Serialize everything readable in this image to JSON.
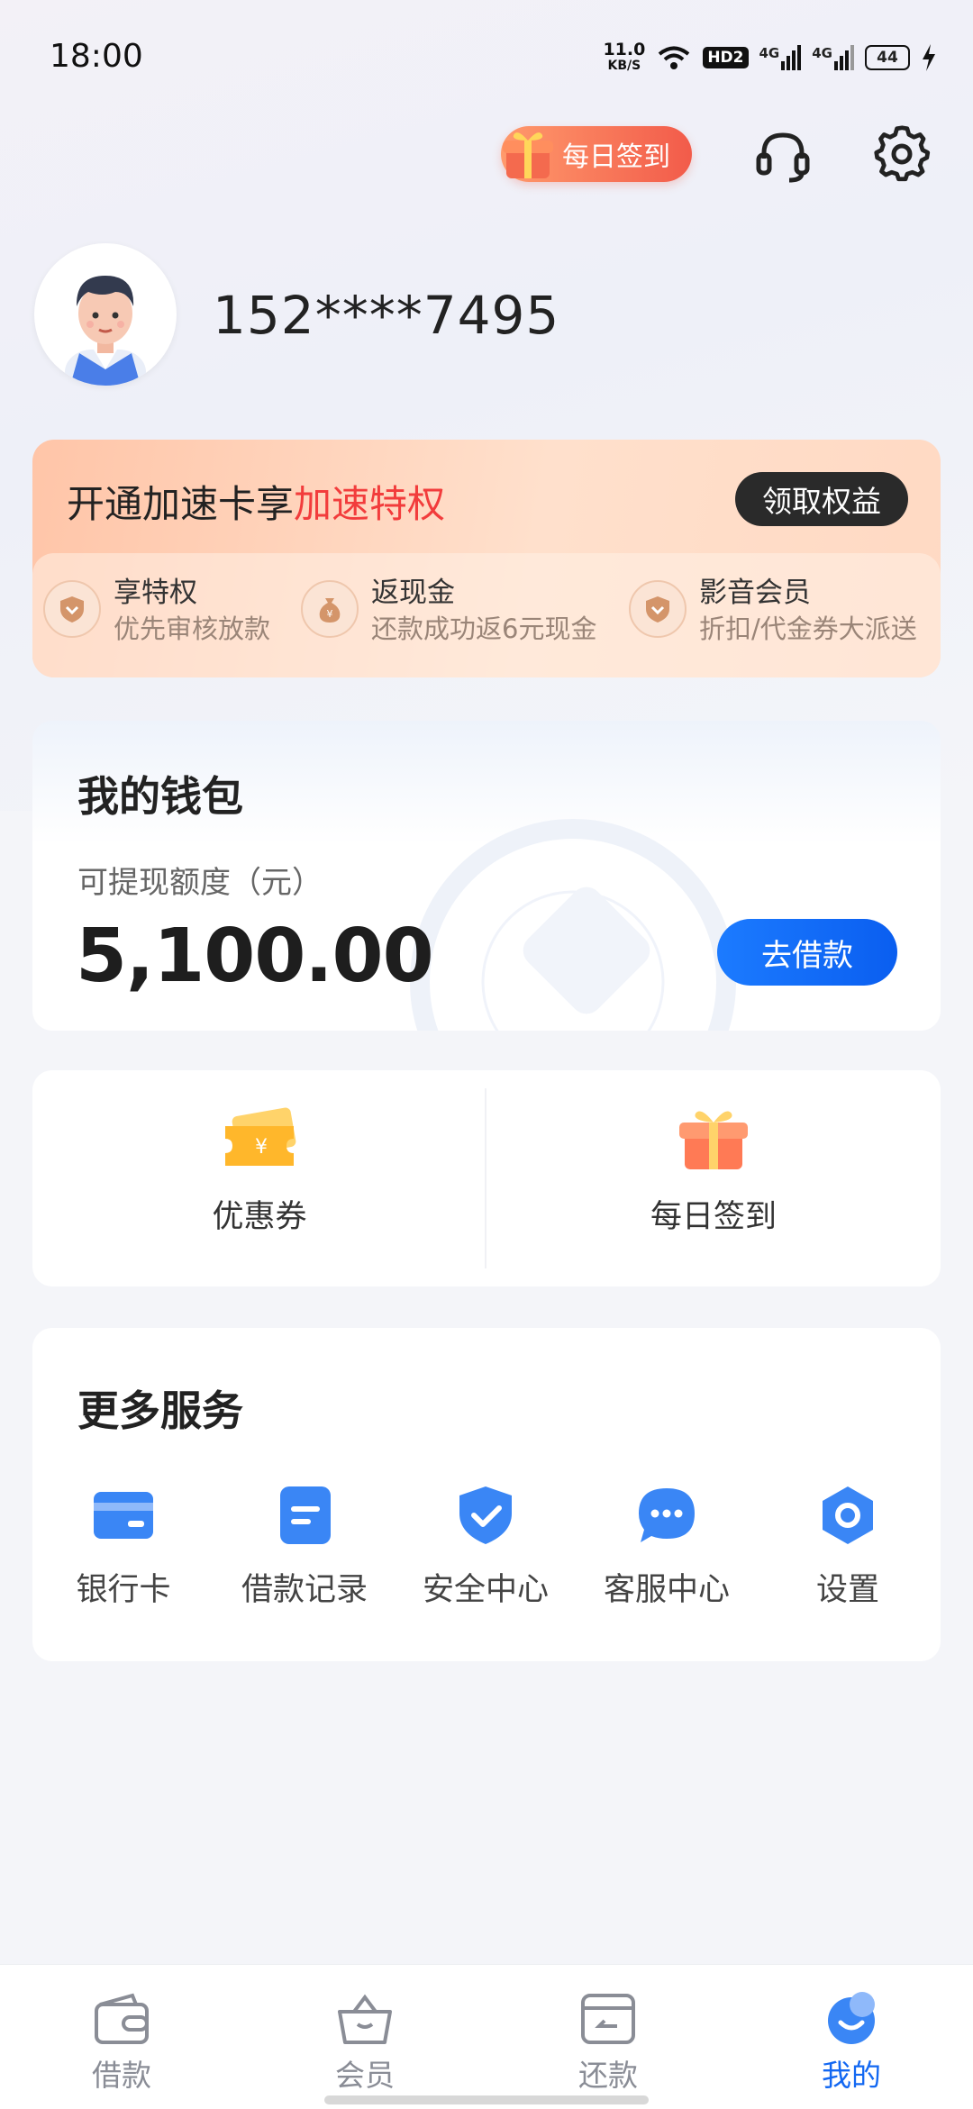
{
  "status_bar": {
    "time": "18:00",
    "net_speed": "11.0",
    "net_unit": "KB/S",
    "hd_badge": "HD2",
    "signal1": "4G",
    "signal2": "4G",
    "battery": "44"
  },
  "header": {
    "checkin_label": "每日签到",
    "icons": [
      "headset-icon",
      "gear-icon"
    ]
  },
  "user": {
    "phone": "152****7495"
  },
  "promo": {
    "title_prefix": "开通加速卡享",
    "title_highlight": "加速特权",
    "button": "领取权益",
    "perks": [
      {
        "title": "享特权",
        "subtitle": "优先审核放款",
        "icon": "heart-shield-icon"
      },
      {
        "title": "返现金",
        "subtitle": "还款成功返6元现金",
        "icon": "money-bag-icon"
      },
      {
        "title": "影音会员",
        "subtitle": "折扣/代金券大派送",
        "icon": "heart-shield-icon"
      }
    ],
    "colors": {
      "highlight": "#f23c3c"
    }
  },
  "wallet": {
    "title": "我的钱包",
    "subtitle": "可提现额度（元）",
    "amount": "5,100.00",
    "button": "去借款",
    "colors": {
      "button": "#0a5ef0"
    }
  },
  "quick": [
    {
      "label": "优惠券",
      "icon": "coupon-ticket-icon"
    },
    {
      "label": "每日签到",
      "icon": "gift-box-icon"
    }
  ],
  "services": {
    "title": "更多服务",
    "items": [
      {
        "label": "银行卡",
        "icon": "bank-card-icon"
      },
      {
        "label": "借款记录",
        "icon": "document-icon"
      },
      {
        "label": "安全中心",
        "icon": "shield-check-icon"
      },
      {
        "label": "客服中心",
        "icon": "chat-bubble-icon"
      },
      {
        "label": "设置",
        "icon": "gear-icon"
      }
    ],
    "colors": {
      "icon": "#3a86f5"
    }
  },
  "tabbar": {
    "items": [
      {
        "label": "借款",
        "icon": "wallet-icon",
        "active": false
      },
      {
        "label": "会员",
        "icon": "basket-icon",
        "active": false
      },
      {
        "label": "还款",
        "icon": "repay-card-icon",
        "active": false
      },
      {
        "label": "我的",
        "icon": "smile-face-icon",
        "active": true
      }
    ],
    "colors": {
      "active": "#1368f2",
      "inactive": "#8a8d96"
    }
  }
}
